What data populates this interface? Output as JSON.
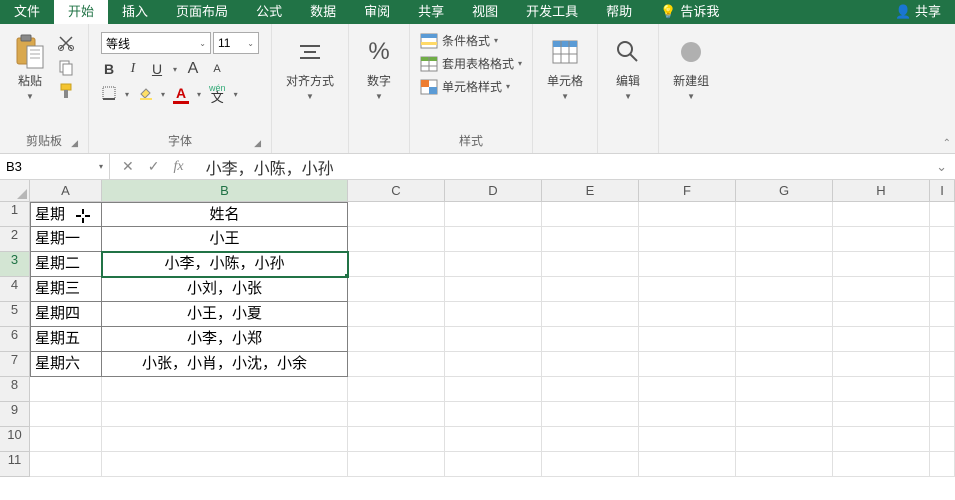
{
  "menu": {
    "tabs": [
      "文件",
      "开始",
      "插入",
      "页面布局",
      "公式",
      "数据",
      "审阅",
      "共享",
      "视图",
      "开发工具",
      "帮助"
    ],
    "tellme": "告诉我",
    "share": "共享"
  },
  "ribbon": {
    "clipboard": {
      "paste": "粘贴",
      "label": "剪贴板"
    },
    "font": {
      "name": "等线",
      "size": "11",
      "btns": {
        "b": "B",
        "i": "I",
        "u": "U",
        "aplus": "A",
        "aminus": "A",
        "wen": "wén\n文"
      },
      "label": "字体"
    },
    "align": {
      "label": "对齐方式"
    },
    "number": {
      "symbol": "%",
      "label": "数字"
    },
    "styles": {
      "cond": "条件格式",
      "table": "套用表格格式",
      "cell": "单元格样式",
      "label": "样式"
    },
    "cells": {
      "label": "单元格"
    },
    "edit": {
      "label": "编辑"
    },
    "newgrp": {
      "label": "新建组"
    }
  },
  "namebox": "B3",
  "formula": "小李，小陈，小孙",
  "columns": [
    "A",
    "B",
    "C",
    "D",
    "E",
    "F",
    "G",
    "H",
    "I"
  ],
  "rows": [
    "1",
    "2",
    "3",
    "4",
    "5",
    "6",
    "7",
    "8",
    "9",
    "10",
    "11"
  ],
  "tableData": [
    {
      "a": "星期",
      "b": "姓名"
    },
    {
      "a": "星期一",
      "b": "小王"
    },
    {
      "a": "星期二",
      "b": "小李，小陈，小孙"
    },
    {
      "a": "星期三",
      "b": "小刘，小张"
    },
    {
      "a": "星期四",
      "b": "小王，小夏"
    },
    {
      "a": "星期五",
      "b": "小李，小郑"
    },
    {
      "a": "星期六",
      "b": "小张，小肖，小沈，小余"
    }
  ]
}
